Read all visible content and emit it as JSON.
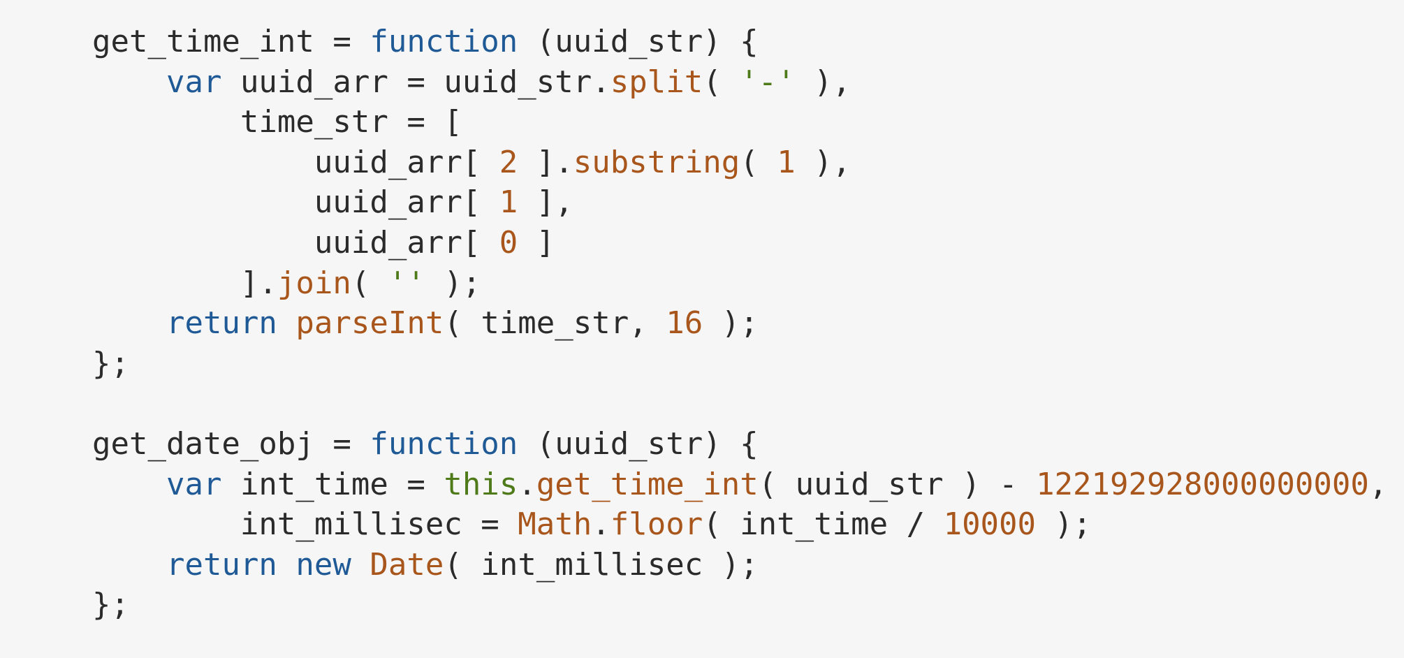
{
  "colors": {
    "background": "#f6f6f6",
    "text": "#2b2b2b",
    "keyword": "#1f5a96",
    "function": "#a8561b",
    "number": "#a8561b",
    "string": "#4f7a1a",
    "this": "#4f7a1a"
  },
  "code": {
    "language": "javascript",
    "lines": [
      [
        {
          "t": "plain",
          "v": "get_time_int = "
        },
        {
          "t": "kw",
          "v": "function"
        },
        {
          "t": "plain",
          "v": " (uuid_str) {"
        }
      ],
      [
        {
          "t": "plain",
          "v": "    "
        },
        {
          "t": "kw",
          "v": "var"
        },
        {
          "t": "plain",
          "v": " uuid_arr = uuid_str."
        },
        {
          "t": "fn",
          "v": "split"
        },
        {
          "t": "plain",
          "v": "( "
        },
        {
          "t": "str",
          "v": "'-'"
        },
        {
          "t": "plain",
          "v": " ),"
        }
      ],
      [
        {
          "t": "plain",
          "v": "        time_str = ["
        }
      ],
      [
        {
          "t": "plain",
          "v": "            uuid_arr[ "
        },
        {
          "t": "num",
          "v": "2"
        },
        {
          "t": "plain",
          "v": " ]."
        },
        {
          "t": "fn",
          "v": "substring"
        },
        {
          "t": "plain",
          "v": "( "
        },
        {
          "t": "num",
          "v": "1"
        },
        {
          "t": "plain",
          "v": " ),"
        }
      ],
      [
        {
          "t": "plain",
          "v": "            uuid_arr[ "
        },
        {
          "t": "num",
          "v": "1"
        },
        {
          "t": "plain",
          "v": " ],"
        }
      ],
      [
        {
          "t": "plain",
          "v": "            uuid_arr[ "
        },
        {
          "t": "num",
          "v": "0"
        },
        {
          "t": "plain",
          "v": " ]"
        }
      ],
      [
        {
          "t": "plain",
          "v": "        ]."
        },
        {
          "t": "fn",
          "v": "join"
        },
        {
          "t": "plain",
          "v": "( "
        },
        {
          "t": "str",
          "v": "''"
        },
        {
          "t": "plain",
          "v": " );"
        }
      ],
      [
        {
          "t": "plain",
          "v": "    "
        },
        {
          "t": "kw",
          "v": "return"
        },
        {
          "t": "plain",
          "v": " "
        },
        {
          "t": "fn",
          "v": "parseInt"
        },
        {
          "t": "plain",
          "v": "( time_str, "
        },
        {
          "t": "num",
          "v": "16"
        },
        {
          "t": "plain",
          "v": " );"
        }
      ],
      [
        {
          "t": "plain",
          "v": "};"
        }
      ],
      [
        {
          "t": "plain",
          "v": ""
        }
      ],
      [
        {
          "t": "plain",
          "v": "get_date_obj = "
        },
        {
          "t": "kw",
          "v": "function"
        },
        {
          "t": "plain",
          "v": " (uuid_str) {"
        }
      ],
      [
        {
          "t": "plain",
          "v": "    "
        },
        {
          "t": "kw",
          "v": "var"
        },
        {
          "t": "plain",
          "v": " int_time = "
        },
        {
          "t": "this",
          "v": "this"
        },
        {
          "t": "plain",
          "v": "."
        },
        {
          "t": "fn",
          "v": "get_time_int"
        },
        {
          "t": "plain",
          "v": "( uuid_str ) - "
        },
        {
          "t": "num",
          "v": "122192928000000000"
        },
        {
          "t": "plain",
          "v": ","
        }
      ],
      [
        {
          "t": "plain",
          "v": "        int_millisec = "
        },
        {
          "t": "fn",
          "v": "Math"
        },
        {
          "t": "plain",
          "v": "."
        },
        {
          "t": "fn",
          "v": "floor"
        },
        {
          "t": "plain",
          "v": "( int_time / "
        },
        {
          "t": "num",
          "v": "10000"
        },
        {
          "t": "plain",
          "v": " );"
        }
      ],
      [
        {
          "t": "plain",
          "v": "    "
        },
        {
          "t": "kw",
          "v": "return"
        },
        {
          "t": "plain",
          "v": " "
        },
        {
          "t": "kw",
          "v": "new"
        },
        {
          "t": "plain",
          "v": " "
        },
        {
          "t": "fn",
          "v": "Date"
        },
        {
          "t": "plain",
          "v": "( int_millisec );"
        }
      ],
      [
        {
          "t": "plain",
          "v": "};"
        }
      ]
    ]
  }
}
